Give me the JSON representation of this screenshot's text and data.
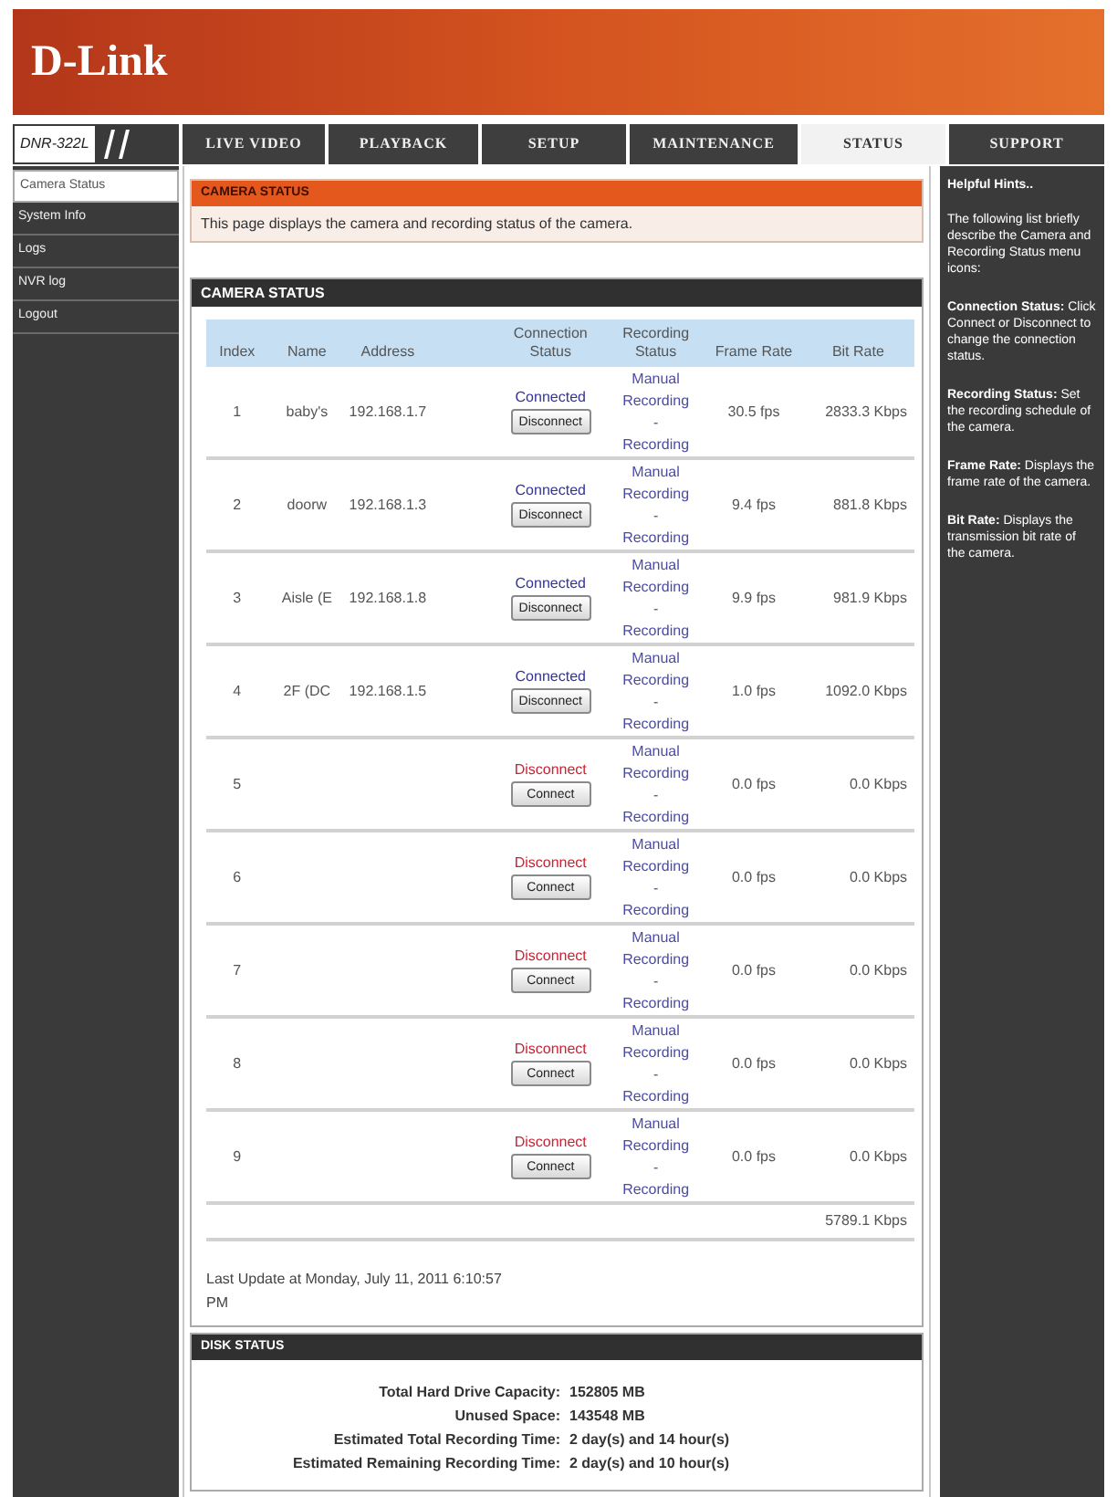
{
  "header": {
    "logo": "D-Link"
  },
  "nav": {
    "model": "DNR-322L",
    "tabs": [
      {
        "label": "LIVE VIDEO",
        "selected": false
      },
      {
        "label": "PLAYBACK",
        "selected": false
      },
      {
        "label": "SETUP",
        "selected": false
      },
      {
        "label": "MAINTENANCE",
        "selected": false
      },
      {
        "label": "STATUS",
        "selected": true
      },
      {
        "label": "SUPPORT",
        "selected": false
      }
    ]
  },
  "sidebar": {
    "items": [
      {
        "label": "Camera Status",
        "selected": true
      },
      {
        "label": "System Info",
        "selected": false
      },
      {
        "label": "Logs",
        "selected": false
      },
      {
        "label": "NVR log",
        "selected": false
      },
      {
        "label": "Logout",
        "selected": false
      }
    ]
  },
  "intro": {
    "title": "CAMERA STATUS",
    "text": "This page displays the camera and recording status of the camera."
  },
  "camera_status": {
    "title": "CAMERA STATUS",
    "columns": [
      "Index",
      "Name",
      "Address",
      "Connection Status",
      "Recording Status",
      "Frame Rate",
      "Bit Rate"
    ],
    "rows": [
      {
        "index": "1",
        "name": "baby's",
        "address": "192.168.1.7",
        "connection": {
          "connected": true,
          "status": "Connected",
          "button": "Disconnect"
        },
        "recording": [
          "Manual Recording",
          "-",
          "Recording"
        ],
        "frame_rate": "30.5 fps",
        "bit_rate": "2833.3 Kbps"
      },
      {
        "index": "2",
        "name": "doorw",
        "address": "192.168.1.3",
        "connection": {
          "connected": true,
          "status": "Connected",
          "button": "Disconnect"
        },
        "recording": [
          "Manual Recording",
          "-",
          "Recording"
        ],
        "frame_rate": "9.4 fps",
        "bit_rate": "881.8 Kbps"
      },
      {
        "index": "3",
        "name": "Aisle (E",
        "address": "192.168.1.8",
        "connection": {
          "connected": true,
          "status": "Connected",
          "button": "Disconnect"
        },
        "recording": [
          "Manual Recording",
          "-",
          "Recording"
        ],
        "frame_rate": "9.9 fps",
        "bit_rate": "981.9 Kbps"
      },
      {
        "index": "4",
        "name": "2F (DC",
        "address": "192.168.1.5",
        "connection": {
          "connected": true,
          "status": "Connected",
          "button": "Disconnect"
        },
        "recording": [
          "Manual Recording",
          "-",
          "Recording"
        ],
        "frame_rate": "1.0 fps",
        "bit_rate": "1092.0 Kbps"
      },
      {
        "index": "5",
        "connection": {
          "connected": false,
          "status": "Disconnect",
          "button": "Connect"
        },
        "recording": [
          "Manual Recording",
          "-",
          "Recording"
        ],
        "frame_rate": "0.0 fps",
        "bit_rate": "0.0 Kbps"
      },
      {
        "index": "6",
        "connection": {
          "connected": false,
          "status": "Disconnect",
          "button": "Connect"
        },
        "recording": [
          "Manual Recording",
          "-",
          "Recording"
        ],
        "frame_rate": "0.0 fps",
        "bit_rate": "0.0 Kbps"
      },
      {
        "index": "7",
        "connection": {
          "connected": false,
          "status": "Disconnect",
          "button": "Connect"
        },
        "recording": [
          "Manual Recording",
          "-",
          "Recording"
        ],
        "frame_rate": "0.0 fps",
        "bit_rate": "0.0 Kbps"
      },
      {
        "index": "8",
        "connection": {
          "connected": false,
          "status": "Disconnect",
          "button": "Connect"
        },
        "recording": [
          "Manual Recording",
          "-",
          "Recording"
        ],
        "frame_rate": "0.0 fps",
        "bit_rate": "0.0 Kbps"
      },
      {
        "index": "9",
        "connection": {
          "connected": false,
          "status": "Disconnect",
          "button": "Connect"
        },
        "recording": [
          "Manual Recording",
          "-",
          "Recording"
        ],
        "frame_rate": "0.0 fps",
        "bit_rate": "0.0 Kbps"
      }
    ],
    "total_bit_rate": "5789.1 Kbps",
    "last_update": "Last Update at Monday, July 11, 2011 6:10:57 PM"
  },
  "disk_status": {
    "title": "DISK STATUS",
    "items": [
      {
        "label": "Total Hard Drive Capacity:",
        "value": "152805 MB"
      },
      {
        "label": "Unused Space:",
        "value": "143548 MB"
      },
      {
        "label": "Estimated Total Recording Time:",
        "value": "2 day(s) and 14 hour(s)"
      },
      {
        "label": "Estimated Remaining Recording Time:",
        "value": "2 day(s) and 10 hour(s)"
      }
    ]
  },
  "hints": {
    "title": "Helpful Hints..",
    "intro": "The following list briefly describe the Camera and Recording Status menu icons:",
    "items": [
      "**Connection Status:** Click Connect or Disconnect to change the connection status.",
      "**Recording Status:** Set the recording schedule of the camera.",
      "**Frame Rate:** Displays the frame rate of the camera.",
      "**Bit Rate:** Displays the transmission bit rate of the camera."
    ]
  }
}
